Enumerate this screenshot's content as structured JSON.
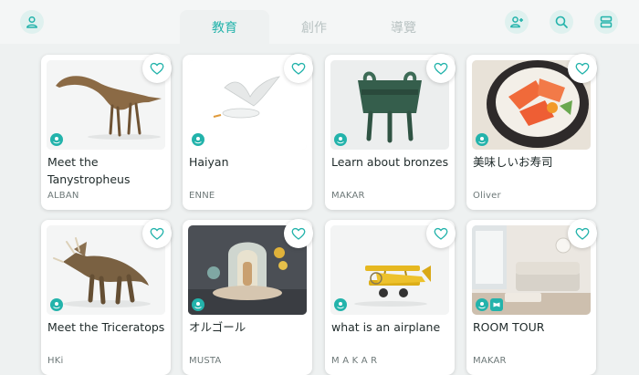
{
  "header": {
    "tabs": [
      {
        "label": "教育",
        "active": true
      },
      {
        "label": "創作",
        "active": false
      },
      {
        "label": "導覽",
        "active": false
      }
    ],
    "icons": [
      "user-icon",
      "add-user-icon",
      "search-icon",
      "menu-icon"
    ]
  },
  "colors": {
    "accent": "#23b3ab",
    "background": "#eef1f1"
  },
  "cards": [
    {
      "title": "Meet the Tanystropheus",
      "author": "ALBAN"
    },
    {
      "title": "Haiyan",
      "author": "ENNE"
    },
    {
      "title": "Learn about bronzes",
      "author": "MAKAR"
    },
    {
      "title": "美味しいお寿司",
      "author": "Oliver"
    },
    {
      "title": "Meet the Triceratops",
      "author": "HKi"
    },
    {
      "title": "オルゴール",
      "author": "MUSTA"
    },
    {
      "title": "what is an airplane",
      "author": "M A K A R"
    },
    {
      "title": "ROOM TOUR",
      "author": "MAKAR"
    }
  ]
}
